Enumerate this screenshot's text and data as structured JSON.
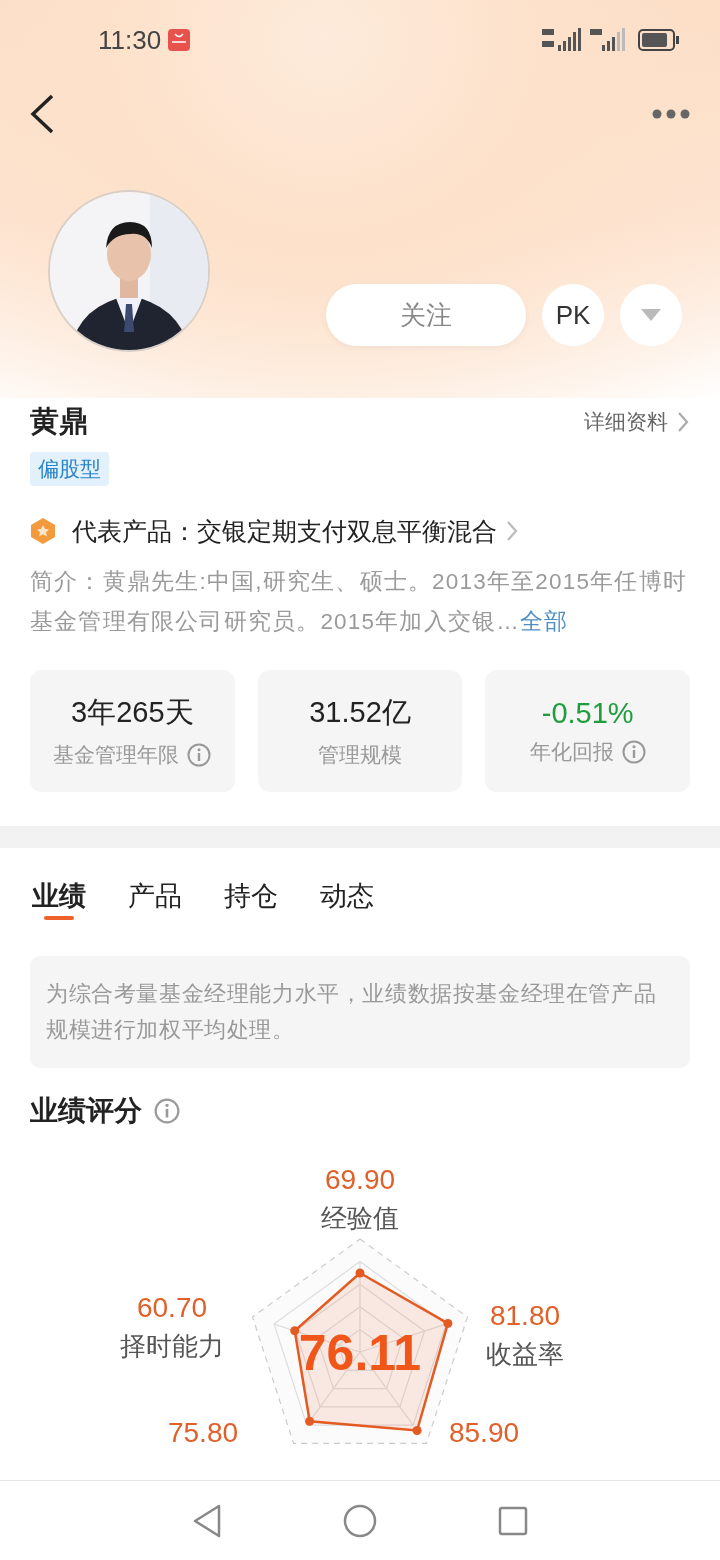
{
  "status_bar": {
    "time": "11:30"
  },
  "manager": {
    "name": "黄鼎",
    "details_link": "详细资料",
    "tag": "偏股型",
    "follow_button": "关注",
    "pk_button": "PK",
    "representative_product": "代表产品：交银定期支付双息平衡混合",
    "intro": "简介：黄鼎先生:中国,研究生、硕士。2013年至2015年任博时基金管理有限公司研究员。2015年加入交银…",
    "intro_more": "全部"
  },
  "stats": [
    {
      "value": "3年265天",
      "label": "基金管理年限",
      "info": true,
      "color": "#222222"
    },
    {
      "value": "31.52亿",
      "label": "管理规模",
      "info": false,
      "color": "#222222"
    },
    {
      "value": "-0.51%",
      "label": "年化回报",
      "info": true,
      "color": "#1f9d3c"
    }
  ],
  "tabs": [
    {
      "label": "业绩",
      "selected": true
    },
    {
      "label": "产品",
      "selected": false
    },
    {
      "label": "持仓",
      "selected": false
    },
    {
      "label": "动态",
      "selected": false
    }
  ],
  "note": "为综合考量基金经理能力水平，业绩数据按基金经理在管产品规模进行加权平均处理。",
  "score_section": {
    "title": "业绩评分",
    "score": "76.11",
    "axes": [
      {
        "value": "69.90",
        "label": "经验值"
      },
      {
        "value": "81.80",
        "label": "收益率"
      },
      {
        "value": "85.90"
      },
      {
        "value": "75.80"
      },
      {
        "value": "60.70",
        "label": "择时能力"
      }
    ]
  }
}
